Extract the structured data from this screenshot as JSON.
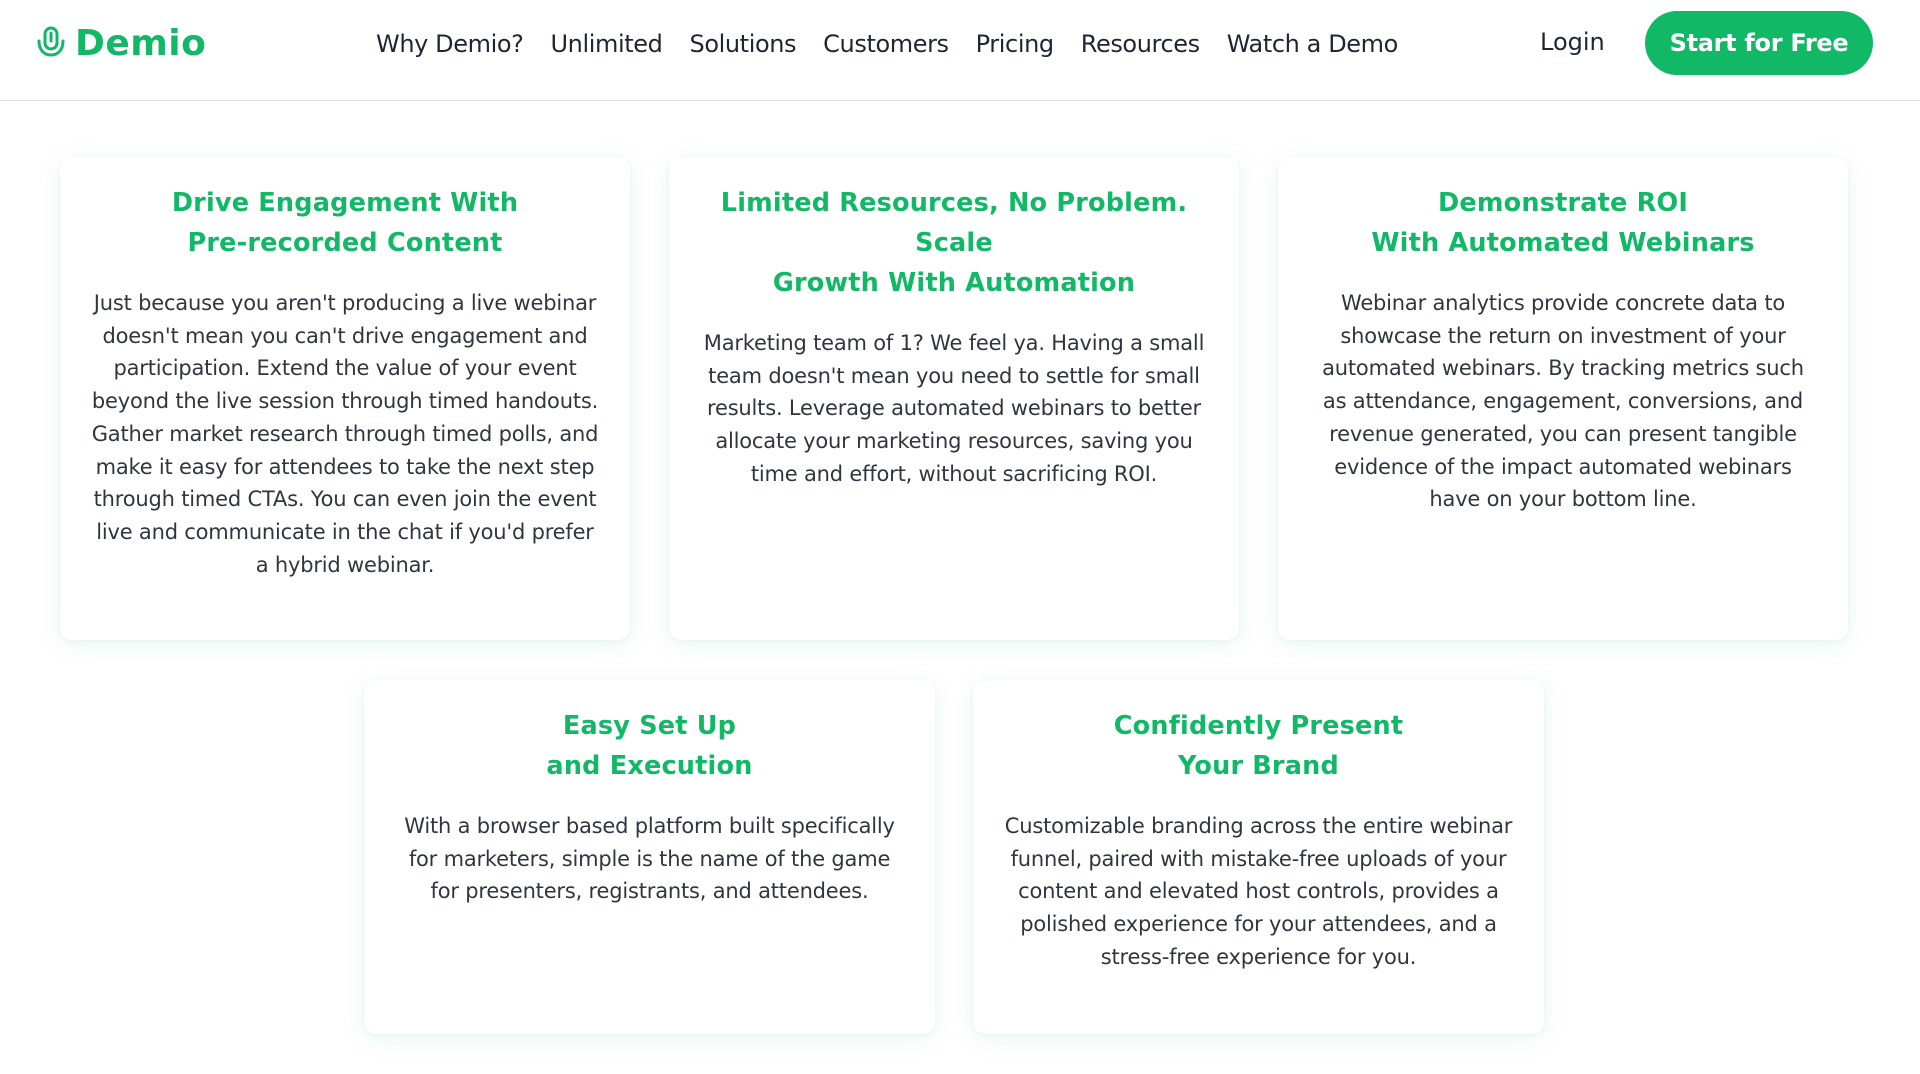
{
  "brand": {
    "name": "Demio",
    "logo_icon": "microphone-icon",
    "accent_color": "#11b866"
  },
  "nav": {
    "links": [
      "Why Demio?",
      "Unlimited",
      "Solutions",
      "Customers",
      "Pricing",
      "Resources",
      "Watch a Demo"
    ],
    "login": "Login",
    "cta": "Start for Free"
  },
  "cards": [
    {
      "title": "Drive Engagement With\nPre-recorded Content",
      "body": "Just because you aren't producing a live webinar doesn't mean you can't drive engagement and participation. Extend the value of your event beyond the live session through timed handouts. Gather market research through timed polls, and make it easy for attendees to take the next step through timed CTAs. You can even join the event live and communicate in the chat if you'd prefer a hybrid webinar."
    },
    {
      "title": "Limited Resources, No Problem. Scale\nGrowth With Automation",
      "body": "Marketing team of 1? We feel ya. Having a small team doesn't mean you need to settle for small results. Leverage automated webinars to better allocate your marketing resources, saving you time and effort, without sacrificing ROI."
    },
    {
      "title": "Demonstrate ROI\nWith Automated Webinars",
      "body": "Webinar analytics provide concrete data to showcase the return on investment of your automated webinars. By tracking metrics such as attendance, engagement, conversions, and revenue generated, you can present tangible evidence of the impact automated webinars have on your bottom line."
    },
    {
      "title": "Easy Set Up\nand Execution",
      "body": "With a browser based platform built specifically for marketers, simple is the name of the game for presenters, registrants, and attendees."
    },
    {
      "title": "Confidently Present\nYour Brand",
      "body": "Customizable branding across the entire webinar funnel, paired with mistake-free uploads of your content and elevated host controls, provides a polished experience for your attendees, and a stress-free experience for you."
    }
  ]
}
